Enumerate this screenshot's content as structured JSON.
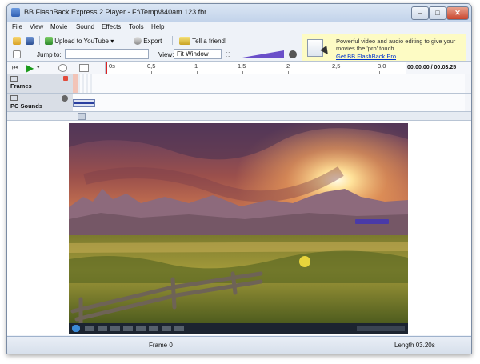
{
  "window": {
    "title": "BB FlashBack Express 2 Player - F:\\Temp\\840am 123.fbr"
  },
  "menu": [
    "File",
    "View",
    "Movie",
    "Sound",
    "Effects",
    "Tools",
    "Help"
  ],
  "toolbar": {
    "upload_label": "Upload to YouTube",
    "export_label": "Export",
    "tell_label": "Tell a friend!",
    "jump_label": "Jump to:",
    "jump_value": "",
    "view_label": "View:",
    "view_value": "Fit Window"
  },
  "promo": {
    "text": "Powerful video and audio editing to give your movies the 'pro' touch.",
    "link": "Get BB FlashBack Pro"
  },
  "timeline": {
    "ticks": [
      "0s",
      "0,5",
      "1",
      "1,5",
      "2",
      "2,5",
      "3,0"
    ],
    "timecode": "00:00.00 / 00:03.25",
    "tracks": [
      "Frames",
      "PC Sounds"
    ]
  },
  "status": {
    "frame": "Frame 0",
    "length": "Length 03.20s"
  },
  "colors": {
    "accent": "#2f5fb3",
    "playhead": "#dd2222",
    "promo_bg": "#fdfbc4"
  },
  "icons": [
    "app-icon",
    "open-folder-icon",
    "save-icon",
    "upload-icon",
    "export-icon",
    "tell-friend-icon",
    "undo-icon",
    "fit-window-icon",
    "volume-icon",
    "play-icon",
    "rewind-icon",
    "promo-monitor-icon",
    "cursor-icon",
    "sound-icon"
  ]
}
